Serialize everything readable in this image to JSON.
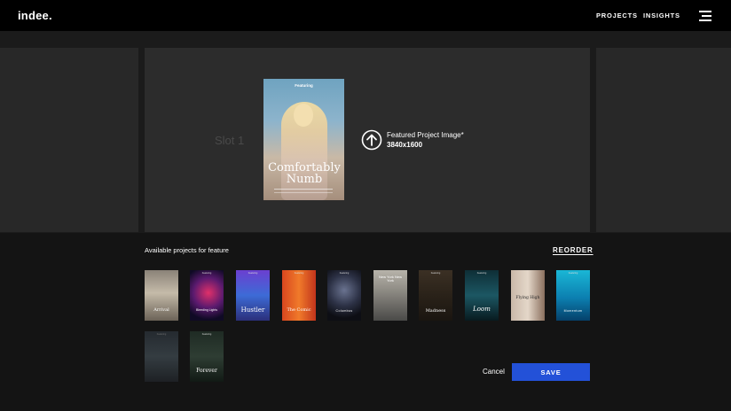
{
  "header": {
    "logo": "indee.",
    "nav": [
      {
        "label": "PROJECTS"
      },
      {
        "label": "INSIGHTS"
      }
    ],
    "menu_icon": "hamburger-menu-icon"
  },
  "slot": {
    "label": "Slot 1",
    "poster": {
      "tag": "Featuring",
      "title": "Comfortably Numb"
    },
    "upload_title": "Featured Project Image*",
    "upload_size": "3840x1600",
    "upload_icon": "upload-arrow-icon"
  },
  "projects": {
    "label": "Available projects for feature",
    "reorder": "REORDER",
    "items": [
      {
        "title": "Arrival",
        "tag": "Featuring"
      },
      {
        "title": "Bleeding Lights",
        "tag": "Featuring"
      },
      {
        "title": "Hustler",
        "tag": "Featuring"
      },
      {
        "title": "The Comic",
        "tag": "Featuring"
      },
      {
        "title": "Columbus",
        "tag": "Featuring"
      },
      {
        "title": "New York New York",
        "tag": "Featuring"
      },
      {
        "title": "Madness",
        "tag": "Featuring"
      },
      {
        "title": "Loom",
        "tag": "Featuring"
      },
      {
        "title": "Flying High",
        "tag": "Featuring"
      },
      {
        "title": "Momentum",
        "tag": "Featuring"
      },
      {
        "title": "",
        "tag": "Featuring"
      },
      {
        "title": "Forever",
        "tag": "Featuring"
      }
    ]
  },
  "actions": {
    "cancel": "Cancel",
    "save": "SAVE"
  },
  "colors": {
    "accent": "#2351d8",
    "topbar": "#000000",
    "panel": "#2c2c2c"
  }
}
